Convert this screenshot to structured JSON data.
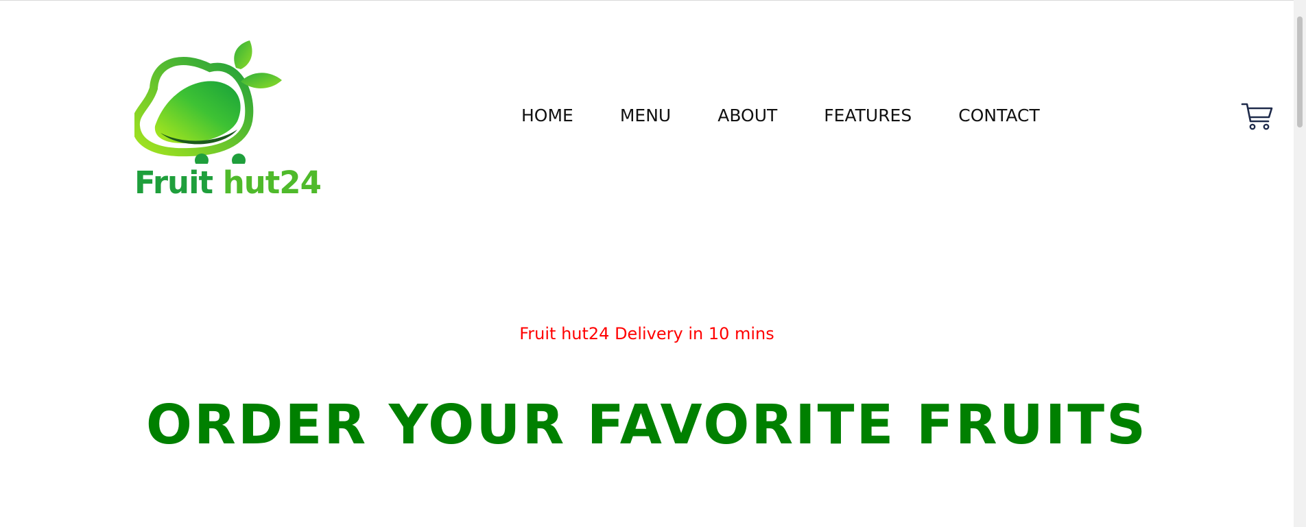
{
  "brand": {
    "word1": "Fruit",
    "word2": "hut24",
    "logo_icon": "mango-cart-icon",
    "colors": {
      "dark_green": "#1f9f3c",
      "light_green": "#4fba2b",
      "lime": "#a6e51f"
    }
  },
  "nav": {
    "items": [
      {
        "label": "HOME"
      },
      {
        "label": "MENU"
      },
      {
        "label": "ABOUT"
      },
      {
        "label": "FEATURES"
      },
      {
        "label": "CONTACT"
      }
    ]
  },
  "cart": {
    "icon": "cart-icon",
    "color": "#1e2a4a"
  },
  "hero": {
    "tagline": "Fruit hut24 Delivery in 10 mins",
    "tagline_color": "#ff0000",
    "heading": "ORDER YOUR FAVORITE FRUITS",
    "heading_color": "#008000"
  }
}
